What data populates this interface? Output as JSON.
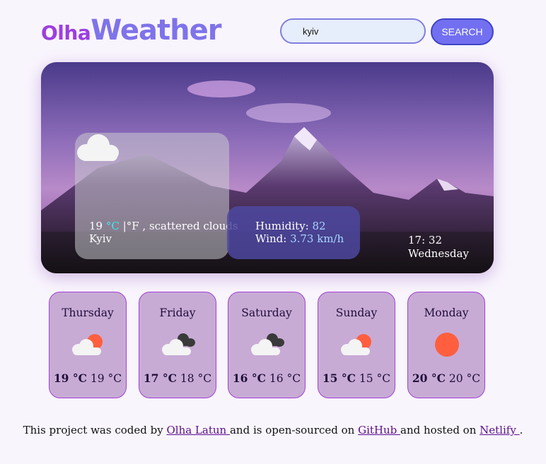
{
  "logo": {
    "part1": "Olha",
    "part2": "Weather"
  },
  "search": {
    "value": "kyiv",
    "button_label": "SEARCH"
  },
  "current": {
    "icon": "cloud-icon",
    "temp": "19",
    "unit_c": "°C",
    "separator": "|",
    "unit_f": "°F",
    "description": ", scattered clouds",
    "city": "Kyiv",
    "humidity_label": "Humidity:",
    "humidity_value": "82",
    "wind_label": "Wind:",
    "wind_value": "3.73 km/h",
    "time": "17: 32",
    "day": "Wednesday"
  },
  "forecast": [
    {
      "day": "Thursday",
      "icon": "sun-cloud-icon",
      "max": "19 °C",
      "min": "19 °C"
    },
    {
      "day": "Friday",
      "icon": "dark-cloud-icon",
      "max": "17 °C",
      "min": "18 °C"
    },
    {
      "day": "Saturday",
      "icon": "dark-cloud-icon",
      "max": "16 °C",
      "min": "16 °C"
    },
    {
      "day": "Sunday",
      "icon": "sun-cloud-icon",
      "max": "15 °C",
      "min": "15 °C"
    },
    {
      "day": "Monday",
      "icon": "sun-icon",
      "max": "20 °C",
      "min": "20 °C"
    }
  ],
  "footer": {
    "t1": "This project was coded by ",
    "link1": "Olha Latun ",
    "t2": "and is open-sourced on ",
    "link2": "GitHub ",
    "t3": "and hosted on ",
    "link3": "Netlify ",
    "t4": "."
  },
  "colors": {
    "accent": "#7270f0",
    "card_border": "#a33fd6",
    "card_bg": "#c8abd5",
    "sun": "#ff5f3f"
  }
}
